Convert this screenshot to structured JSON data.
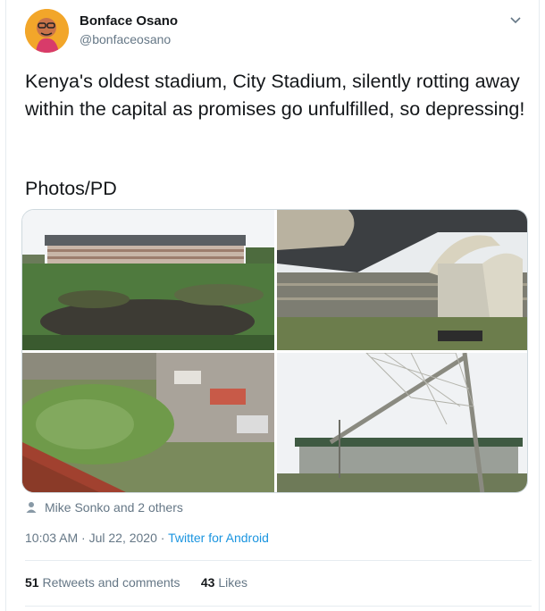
{
  "author": {
    "name": "Bonface Osano",
    "handle": "@bonfaceosano"
  },
  "tweet": {
    "text": "Kenya's oldest stadium, City Stadium, silently rotting away within the capital as promises go unfulfilled, so depressing!",
    "credit": "Photos/PD"
  },
  "meta": {
    "tagged": "Mike Sonko and 2 others",
    "time": "10:03 AM · Jul 22, 2020 · ",
    "source": "Twitter for Android"
  },
  "stats": {
    "retweets_count": "51",
    "retweets_label": "Retweets and comments",
    "likes_count": "43",
    "likes_label": "Likes"
  },
  "icons": {
    "menu": "chevron-down-icon",
    "people": "person-icon"
  },
  "colors": {
    "link": "#1b95e0",
    "muted": "#657786",
    "text": "#14171a"
  }
}
